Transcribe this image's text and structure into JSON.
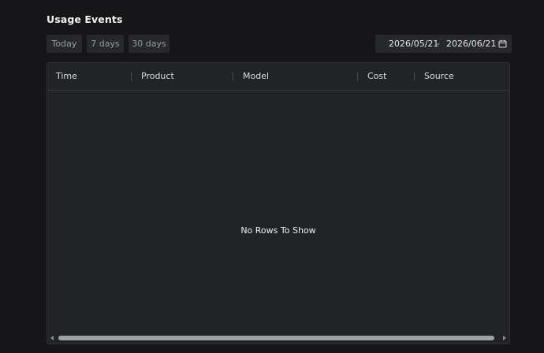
{
  "header": {
    "title": "Usage Events"
  },
  "range_buttons": [
    {
      "label": "Today"
    },
    {
      "label": "7 days"
    },
    {
      "label": "30 days"
    }
  ],
  "date_range": {
    "start": "2026/05/21",
    "separator": "-",
    "end": "2026/06/21",
    "icon": "calendar-icon"
  },
  "table": {
    "columns": [
      "Time",
      "Product",
      "Model",
      "Cost",
      "Source"
    ],
    "rows": [],
    "empty_message": "No Rows To Show"
  },
  "colors": {
    "background": "#161618",
    "panel": "#222326",
    "button_bg": "#27282b",
    "scroll_thumb": "#9fa0a4"
  }
}
